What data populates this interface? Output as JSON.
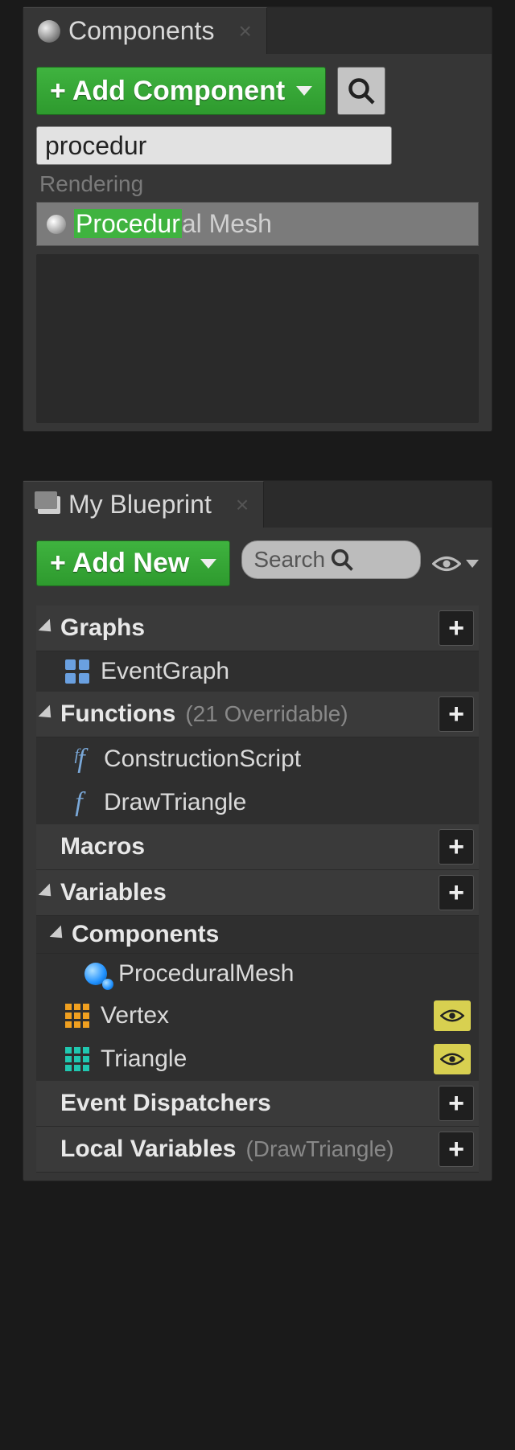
{
  "componentsPanel": {
    "tabTitle": "Components",
    "addLabel": "Add Component",
    "searchValue": "procedur",
    "categoryLabel": "Rendering",
    "result": {
      "highlighted": "Procedur",
      "remainder": "al Mesh"
    }
  },
  "blueprintPanel": {
    "tabTitle": "My Blueprint",
    "addNewLabel": "Add New",
    "searchPlaceholder": "Search",
    "sections": {
      "graphs": {
        "title": "Graphs"
      },
      "functions": {
        "title": "Functions",
        "annotation": "(21 Overridable)"
      },
      "macros": {
        "title": "Macros"
      },
      "variables": {
        "title": "Variables"
      },
      "components": {
        "title": "Components"
      },
      "eventDispatchers": {
        "title": "Event Dispatchers"
      },
      "localVariables": {
        "title": "Local Variables",
        "annotation": "(DrawTriangle)"
      }
    },
    "items": {
      "eventGraph": "EventGraph",
      "constructionScript": "ConstructionScript",
      "drawTriangle": "DrawTriangle",
      "proceduralMesh": "ProceduralMesh",
      "vertex": "Vertex",
      "triangle": "Triangle"
    }
  }
}
